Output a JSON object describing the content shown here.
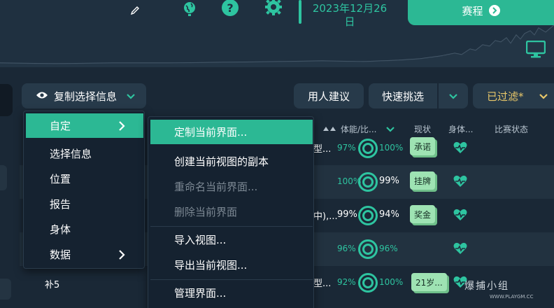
{
  "header": {
    "date": "2023年12月26日",
    "fixtures_label": "赛程",
    "icons": [
      "pencil-icon",
      "globe-icon",
      "help-icon",
      "gear-icon",
      "monitor-icon"
    ],
    "accent_color": "#2ec4a0"
  },
  "toolbar": {
    "copy_label": "复制选择信息",
    "advice_label": "用人建议",
    "quick_label": "快速挑选",
    "filter_label": "已过滤*"
  },
  "table": {
    "headers": {
      "stamina": "体能/比...",
      "status": "现状",
      "body": "身体...",
      "match_status": "比赛状态"
    },
    "rows": [
      {
        "left": "",
        "frag": "型...",
        "p1": "97%",
        "p2": "100%",
        "badge": "承诺"
      },
      {
        "left": "",
        "frag": "",
        "p1": "100%",
        "p2": "99%",
        "badge": "挂牌"
      },
      {
        "left": "",
        "frag": "中),...",
        "p1": "99%",
        "p2": "94%",
        "badge": "奖金"
      },
      {
        "left": "",
        "frag": "",
        "p1": "96%",
        "p2": "96%",
        "badge": ""
      },
      {
        "left": "补5",
        "frag": "型...",
        "p1": "92%",
        "p2": "100%",
        "badge": "21岁..."
      }
    ]
  },
  "menu_main": {
    "items": [
      "自定",
      "选择信息",
      "位置",
      "报告",
      "身体",
      "数据"
    ]
  },
  "menu_sub": {
    "items": [
      "定制当前界面...",
      "创建当前视图的副本",
      "重命名当前界面...",
      "删除当前界面",
      "导入视图...",
      "导出当前视图...",
      "管理界面..."
    ]
  },
  "watermark": {
    "text": "爆捕小组",
    "url": "WWW.PLAYGM.CC"
  }
}
